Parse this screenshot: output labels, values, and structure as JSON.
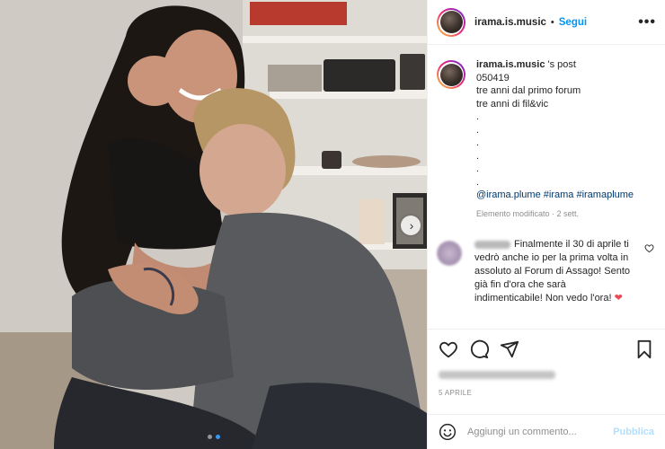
{
  "header": {
    "username": "irama.is.music",
    "separator": "•",
    "follow_label": "Segui",
    "more_icon": "more-horizontal-icon"
  },
  "caption": {
    "username": "irama.is.music",
    "suffix": " 's post",
    "lines": [
      "050419",
      "tre anni dal primo forum",
      "tre anni di fil&vic",
      ".",
      ".",
      ".",
      ".",
      ".",
      "."
    ],
    "tags": [
      "@irama.plume",
      "#irama",
      "#iramaplume"
    ],
    "meta": "Elemento modificato · 2 sett."
  },
  "comment": {
    "text": "Finalmente il 30 di aprile ti vedrò anche io per la prima volta in assoluto al Forum di Assago! Sento già fin d'ora che sarà indimenticabile! Non vedo l'ora!",
    "emoji": "❤",
    "like_icon": "heart-outline-icon"
  },
  "actions": {
    "icons": [
      "heart-icon",
      "comment-icon",
      "share-icon",
      "bookmark-icon"
    ],
    "date": "5 APRILE"
  },
  "add_comment": {
    "placeholder": "Aggiungi un commento...",
    "publish_label": "Pubblica",
    "emoji_icon": "smiley-icon"
  },
  "carousel": {
    "next_icon": "chevron-right-icon",
    "total": 2,
    "current": 2
  },
  "colors": {
    "accent": "#0095f6",
    "publish_disabled": "#b2dffc",
    "heart_red": "#ed4956",
    "meta_gray": "#8e8e8e"
  }
}
